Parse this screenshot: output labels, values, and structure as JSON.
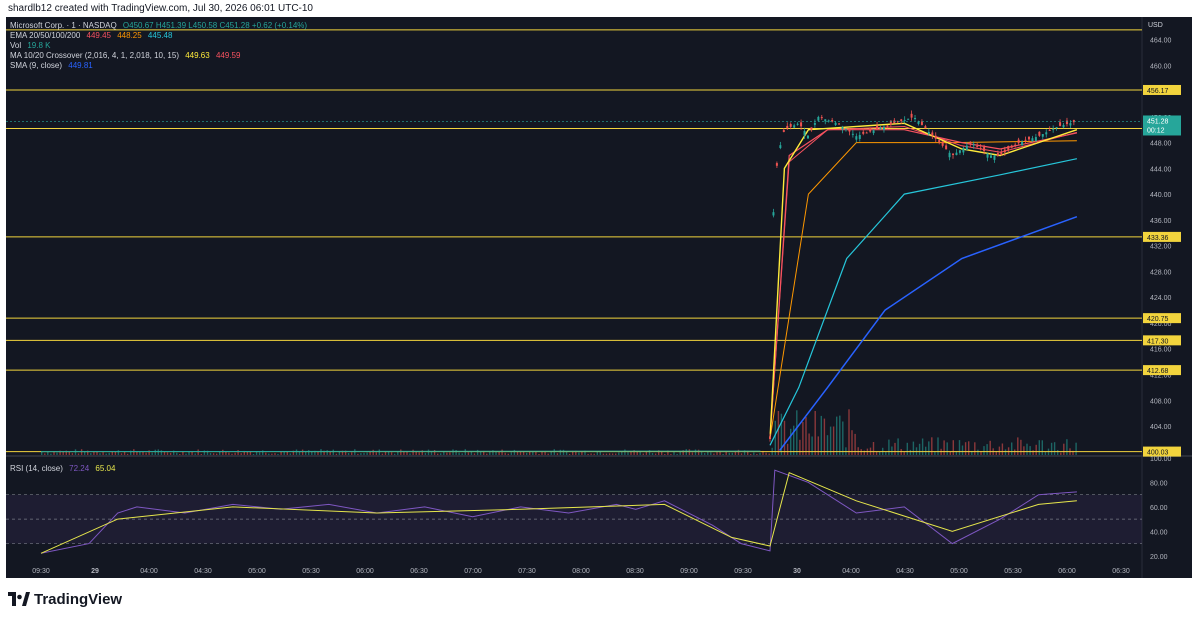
{
  "credit": "shardlb12 created with TradingView.com, Jul 30, 2026 06:01 UTC-10",
  "legend": {
    "title": "Microsoft Corp. · 1 · NASDAQ",
    "ohlc": "O450.67 H451.39 L450.58 C451.28 +0.62 (+0.14%)",
    "ema_label": "EMA 20/50/100/200",
    "ema_values": [
      "449.45",
      "448.25",
      "445.48"
    ],
    "vol_label": "Vol",
    "vol_value": "19.8 K",
    "ma_label": "MA 10/20 Crossover (2,016, 4, 1, 2,018, 10, 15)",
    "ma_values": [
      "449.63",
      "449.59"
    ],
    "sma_label": "SMA (9, close)",
    "sma_value": "449.81",
    "rsi_label": "RSI (14, close)",
    "rsi_values": [
      "72.24",
      "65.04"
    ]
  },
  "currency": "USD",
  "brand": "TradingView",
  "countdown": "00:12",
  "colors": {
    "background": "#131722",
    "level_line": "#f2d43d",
    "ema20": "#f7525f",
    "ema50": "#ff9800",
    "ema100": "#26c6da",
    "ema200": "#2962ff",
    "sma": "#ffeb3b",
    "rsi": "#7e57c2",
    "rsi_ma": "#e6e64c",
    "up": "#26a69a",
    "down": "#ef5350"
  },
  "chart_data": {
    "type": "candlestick",
    "symbol": "Microsoft Corp.",
    "interval": "1",
    "exchange": "NASDAQ",
    "ylim": [
      399.5,
      467.5
    ],
    "y_ticks": [
      "464.00",
      "460.00",
      "456.00",
      "452.00",
      "448.00",
      "444.00",
      "440.00",
      "436.00",
      "432.00",
      "428.00",
      "424.00",
      "420.00",
      "416.00",
      "412.00",
      "408.00",
      "404.00",
      "400.00"
    ],
    "x_ticks": [
      "09:30",
      "29",
      "04:00",
      "04:30",
      "05:00",
      "05:30",
      "06:00",
      "06:30",
      "07:00",
      "07:30",
      "08:00",
      "08:30",
      "09:00",
      "09:30",
      "30",
      "04:00",
      "04:30",
      "05:00",
      "05:30",
      "06:00",
      "06:30"
    ],
    "horizontal_levels": [
      {
        "value": 465.5,
        "label": ""
      },
      {
        "value": 456.17,
        "label": "456.17"
      },
      {
        "value": 450.18,
        "label": "450.18"
      },
      {
        "value": 433.36,
        "label": "433.36"
      },
      {
        "value": 420.75,
        "label": "420.75"
      },
      {
        "value": 417.3,
        "label": "417.30"
      },
      {
        "value": 412.68,
        "label": "412.68"
      },
      {
        "value": 400.03,
        "label": "400.03"
      }
    ],
    "last_price": "451.28",
    "price_path": [
      [
        0,
        400.03
      ],
      [
        0.75,
        400.1
      ],
      [
        0.76,
        402
      ],
      [
        0.762,
        434
      ],
      [
        0.768,
        446
      ],
      [
        0.775,
        450
      ],
      [
        0.79,
        451
      ],
      [
        0.8,
        449
      ],
      [
        0.81,
        452
      ],
      [
        0.83,
        451
      ],
      [
        0.85,
        449
      ],
      [
        0.87,
        450
      ],
      [
        0.89,
        451
      ],
      [
        0.91,
        452
      ],
      [
        0.93,
        449
      ],
      [
        0.95,
        446
      ],
      [
        0.97,
        448
      ],
      [
        0.99,
        446
      ],
      [
        1.0,
        446
      ],
      [
        1.02,
        448
      ],
      [
        1.04,
        449
      ],
      [
        1.06,
        450.5
      ],
      [
        1.08,
        451.3
      ]
    ],
    "ema_paths": {
      "ema20": [
        [
          0.76,
          402
        ],
        [
          0.78,
          446
        ],
        [
          0.82,
          450
        ],
        [
          0.9,
          450
        ],
        [
          0.96,
          448
        ],
        [
          1.0,
          447
        ],
        [
          1.08,
          449.5
        ]
      ],
      "ema50": [
        [
          0.76,
          402
        ],
        [
          0.8,
          440
        ],
        [
          0.85,
          448
        ],
        [
          0.95,
          448
        ],
        [
          1.08,
          448.3
        ]
      ],
      "ema100": [
        [
          0.76,
          401
        ],
        [
          0.79,
          410
        ],
        [
          0.84,
          430
        ],
        [
          0.9,
          440
        ],
        [
          1.0,
          443
        ],
        [
          1.08,
          445.5
        ]
      ],
      "ema200": [
        [
          0.77,
          400.2
        ],
        [
          0.82,
          410
        ],
        [
          0.88,
          422
        ],
        [
          0.96,
          430
        ],
        [
          1.08,
          436.5
        ]
      ]
    },
    "sma9": [
      [
        0.76,
        402
      ],
      [
        0.775,
        444
      ],
      [
        0.8,
        450
      ],
      [
        0.9,
        451
      ],
      [
        0.96,
        447
      ],
      [
        1.0,
        446
      ],
      [
        1.08,
        450
      ]
    ],
    "ma_crossover": [
      [
        0.76,
        402
      ],
      [
        0.78,
        445
      ],
      [
        0.82,
        450
      ],
      [
        0.9,
        450.5
      ],
      [
        0.96,
        447.5
      ],
      [
        1.0,
        446.5
      ],
      [
        1.08,
        449.6
      ]
    ],
    "rsi": {
      "ylim": [
        10,
        100
      ],
      "y_ticks": [
        "100.00",
        "80.00",
        "60.00",
        "40.00",
        "20.00"
      ],
      "bands": [
        70,
        50,
        30
      ],
      "rsi_path": [
        [
          0.0,
          22
        ],
        [
          0.05,
          30
        ],
        [
          0.08,
          55
        ],
        [
          0.1,
          60
        ],
        [
          0.15,
          55
        ],
        [
          0.2,
          62
        ],
        [
          0.25,
          58
        ],
        [
          0.3,
          62
        ],
        [
          0.35,
          55
        ],
        [
          0.4,
          60
        ],
        [
          0.45,
          52
        ],
        [
          0.5,
          60
        ],
        [
          0.55,
          55
        ],
        [
          0.6,
          62
        ],
        [
          0.62,
          58
        ],
        [
          0.65,
          65
        ],
        [
          0.7,
          45
        ],
        [
          0.73,
          30
        ],
        [
          0.76,
          24
        ],
        [
          0.765,
          90
        ],
        [
          0.8,
          80
        ],
        [
          0.85,
          55
        ],
        [
          0.9,
          60
        ],
        [
          0.95,
          30
        ],
        [
          1.0,
          50
        ],
        [
          1.04,
          70
        ],
        [
          1.08,
          72.24
        ]
      ],
      "rsi_ma_path": [
        [
          0.0,
          22
        ],
        [
          0.08,
          50
        ],
        [
          0.2,
          60
        ],
        [
          0.35,
          55
        ],
        [
          0.5,
          58
        ],
        [
          0.65,
          62
        ],
        [
          0.72,
          35
        ],
        [
          0.76,
          28
        ],
        [
          0.78,
          88
        ],
        [
          0.85,
          65
        ],
        [
          0.95,
          40
        ],
        [
          1.04,
          62
        ],
        [
          1.08,
          65.04
        ]
      ]
    }
  }
}
